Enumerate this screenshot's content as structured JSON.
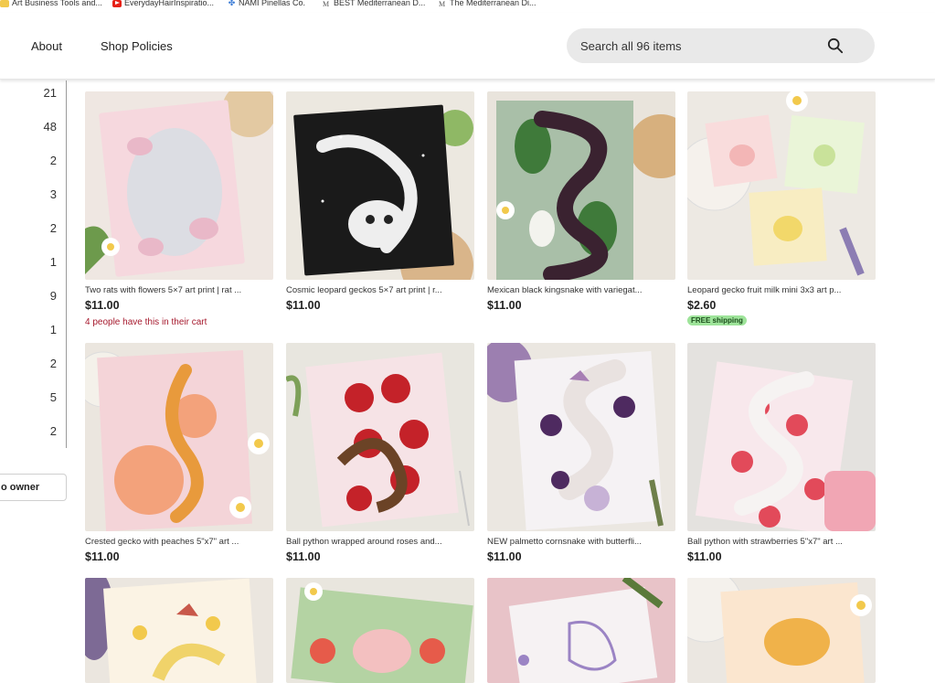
{
  "bookmarks": [
    {
      "label": "Art Business Tools and...",
      "icon": "folder-icon"
    },
    {
      "label": "EverydayHairInspiratio...",
      "icon": "youtube-icon"
    },
    {
      "label": "NAMI Pinellas Co.",
      "icon": "nami-icon"
    },
    {
      "label": "BEST Mediterranean D...",
      "icon": "site-m-icon"
    },
    {
      "label": "The Mediterranean Di...",
      "icon": "site-m-icon"
    }
  ],
  "nav": {
    "about_label": "About",
    "policies_label": "Shop Policies",
    "search_placeholder": "Search all 96 items"
  },
  "section_counts": [
    "21",
    "48",
    "2",
    "3",
    "2",
    "1",
    "9",
    "1",
    "2",
    "5",
    "2"
  ],
  "owner_button_label": "o owner",
  "listings": [
    {
      "title": "Two rats with flowers 5×7 art print | rat ...",
      "price": "$11.00",
      "extra": "4 people have this in their cart",
      "badge": ""
    },
    {
      "title": "Cosmic leopard geckos 5×7 art print | r...",
      "price": "$11.00",
      "extra": "",
      "badge": ""
    },
    {
      "title": "Mexican black kingsnake with variegat...",
      "price": "$11.00",
      "extra": "",
      "badge": ""
    },
    {
      "title": "Leopard gecko fruit milk mini 3x3 art p...",
      "price": "$2.60",
      "extra": "",
      "badge": "FREE shipping"
    },
    {
      "title": "Crested gecko with peaches 5\"x7\" art ...",
      "price": "$11.00",
      "extra": "",
      "badge": ""
    },
    {
      "title": "Ball python wrapped around roses and...",
      "price": "$11.00",
      "extra": "",
      "badge": ""
    },
    {
      "title": "NEW palmetto cornsnake with butterfli...",
      "price": "$11.00",
      "extra": "",
      "badge": ""
    },
    {
      "title": "Ball python with strawberries 5\"x7\" art ...",
      "price": "$11.00",
      "extra": "",
      "badge": ""
    },
    {
      "title": "",
      "price": "",
      "extra": "",
      "badge": ""
    },
    {
      "title": "",
      "price": "",
      "extra": "",
      "badge": ""
    },
    {
      "title": "",
      "price": "",
      "extra": "",
      "badge": ""
    },
    {
      "title": "",
      "price": "",
      "extra": "",
      "badge": ""
    }
  ]
}
